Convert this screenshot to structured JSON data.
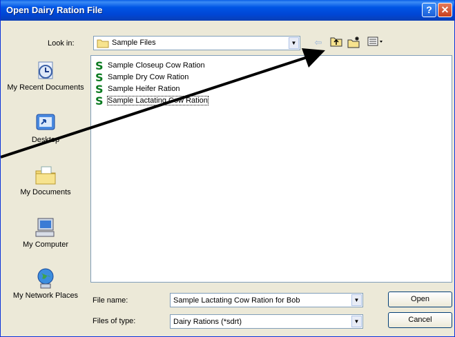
{
  "window": {
    "title": "Open Dairy Ration File"
  },
  "title_buttons": {
    "help": "?",
    "close": "✕"
  },
  "look_in": {
    "label": "Look in:",
    "value": "Sample Files"
  },
  "toolbar": {
    "back_icon": "back-arrow-icon",
    "up_icon": "up-folder-icon",
    "new_folder_icon": "new-folder-icon",
    "views_icon": "views-menu-icon"
  },
  "places": [
    {
      "label": "My Recent Documents",
      "icon": "recent-documents-icon"
    },
    {
      "label": "Desktop",
      "icon": "desktop-icon"
    },
    {
      "label": "My Documents",
      "icon": "my-documents-icon"
    },
    {
      "label": "My Computer",
      "icon": "my-computer-icon"
    },
    {
      "label": "My Network Places",
      "icon": "network-places-icon"
    }
  ],
  "files": [
    {
      "name": "Sample Closeup Cow Ration",
      "selected": false
    },
    {
      "name": "Sample Dry Cow Ration",
      "selected": false
    },
    {
      "name": "Sample Heifer Ration",
      "selected": false
    },
    {
      "name": "Sample Lactating Cow Ration",
      "selected": true
    }
  ],
  "file_name": {
    "label": "File name:",
    "value": "Sample Lactating Cow Ration for Bob"
  },
  "file_type": {
    "label": "Files of type:",
    "value": "Dairy Rations (*sdrt)"
  },
  "buttons": {
    "open": "Open",
    "cancel": "Cancel"
  },
  "colors": {
    "title_bar": "#0055e5",
    "selection_icon": "#0a7a20",
    "annotation_arrow": "#000000"
  }
}
